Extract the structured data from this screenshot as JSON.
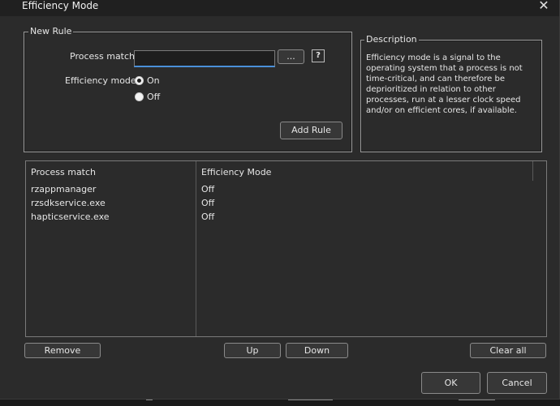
{
  "window": {
    "title": "Efficiency Mode",
    "close_icon": "close-icon"
  },
  "new_rule": {
    "legend": "New Rule",
    "process_match_label": "Process match:",
    "process_match_value": "",
    "browse_label": "...",
    "help_label": "?",
    "efficiency_mode_label": "Efficiency mode:",
    "on_label": "On",
    "off_label": "Off",
    "selected": "On",
    "add_rule_label": "Add Rule"
  },
  "description": {
    "legend": "Description",
    "text": "Efficiency mode is a signal to the operating system that a process is not time-critical, and can therefore be deprioritized in relation to other processes, run at a lesser clock speed and/or on efficient cores, if available."
  },
  "table": {
    "headers": [
      "Process match",
      "Efficiency Mode"
    ],
    "rows": [
      [
        "rzappmanager",
        "Off"
      ],
      [
        "rzsdkservice.exe",
        "Off"
      ],
      [
        "hapticservice.exe",
        "Off"
      ]
    ]
  },
  "buttons": {
    "remove": "Remove",
    "up": "Up",
    "down": "Down",
    "clear_all": "Clear all",
    "ok": "OK",
    "cancel": "Cancel"
  },
  "colors": {
    "accent": "#4a90d9",
    "dialog_bg": "#2b2b2b",
    "titlebar_bg": "#202020"
  }
}
